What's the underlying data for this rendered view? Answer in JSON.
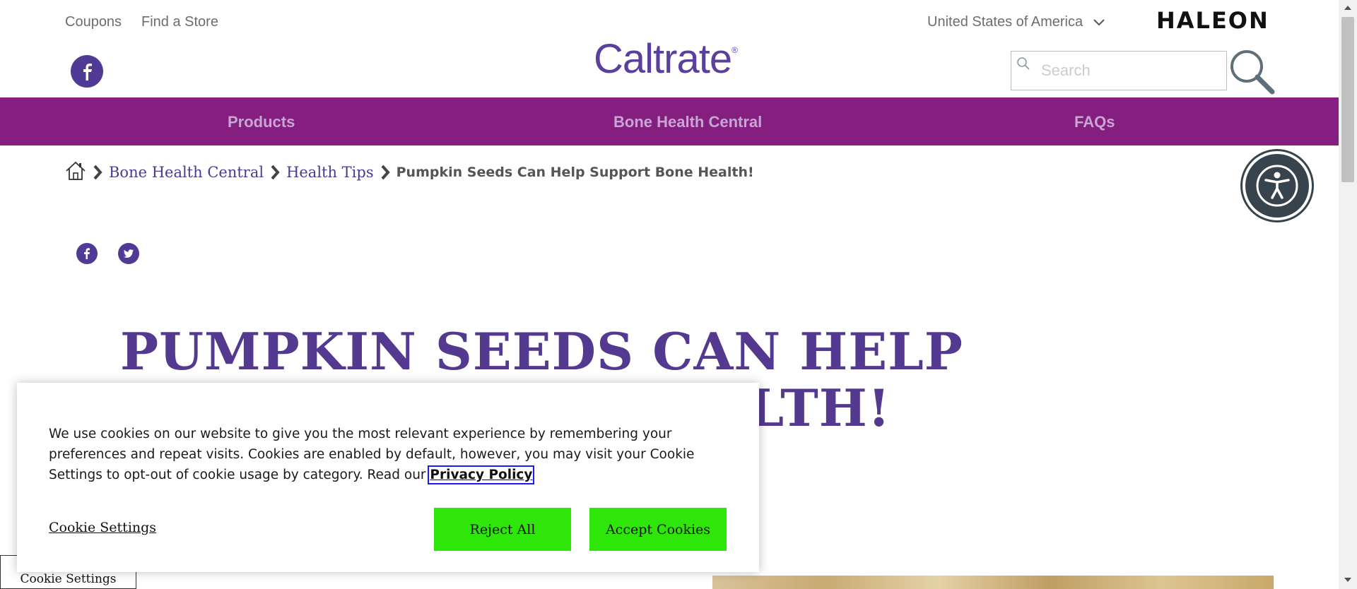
{
  "header": {
    "coupons_label": "Coupons",
    "find_store_label": "Find a Store",
    "country_label": "United States of America",
    "haleon_logo": "HALEON",
    "brand_logo": "Caltrate",
    "brand_reg": "®",
    "search_placeholder": "Search"
  },
  "nav": {
    "items": [
      {
        "label": "Products"
      },
      {
        "label": "Bone Health Central"
      },
      {
        "label": "FAQs"
      }
    ]
  },
  "breadcrumb": {
    "items": [
      {
        "label": "Bone Health Central"
      },
      {
        "label": "Health Tips"
      }
    ],
    "current": "Pumpkin Seeds Can Help Support Bone Health!"
  },
  "article": {
    "title": "PUMPKIN SEEDS CAN HELP SUPPORT BONE HEALTH!"
  },
  "cookie_banner": {
    "text": "We use cookies on our website to give you the most relevant experience by remembering your preferences and repeat visits. Cookies are enabled by default, however, you may visit your Cookie Settings to opt-out of cookie usage by category. Read our ",
    "privacy_link": "Privacy Policy",
    "settings_label": "Cookie Settings",
    "reject_label": "Reject All",
    "accept_label": "Accept Cookies"
  },
  "floating_cookie_label": "Cookie Settings",
  "colors": {
    "brand_purple": "#53398f",
    "nav_bg": "#841e7f",
    "cookie_button": "#2ee60a",
    "a11y_bg": "#37444d"
  },
  "icons": [
    "facebook-icon",
    "search-icon",
    "chevron-down-icon",
    "home-icon",
    "chevron-right-icon",
    "twitter-icon",
    "accessibility-icon"
  ]
}
